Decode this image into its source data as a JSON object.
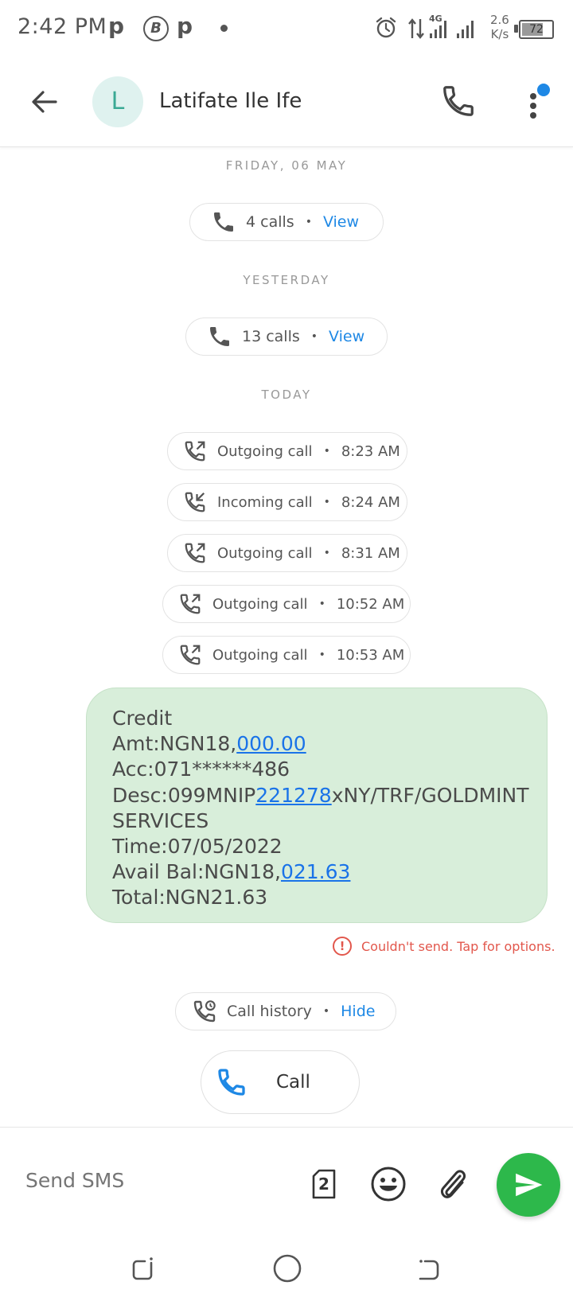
{
  "status_bar": {
    "time": "2:42 PM",
    "notification_icons": [
      "p",
      "B",
      "p"
    ],
    "network": "4G",
    "speed_value": "2.6",
    "speed_unit": "K/s",
    "battery": "72"
  },
  "header": {
    "avatar_letter": "L",
    "contact_name": "Latifate  Ile Ife"
  },
  "conversation": {
    "date_friday": "FRIDAY, 06 MAY",
    "friday_calls": {
      "label": "4 calls",
      "action": "View"
    },
    "date_yesterday": "YESTERDAY",
    "yesterday_calls": {
      "label": "13 calls",
      "action": "View"
    },
    "date_today": "TODAY",
    "call_log": [
      {
        "type": "Outgoing call",
        "time": "8:23 AM"
      },
      {
        "type": "Incoming call",
        "time": "8:24 AM"
      },
      {
        "type": "Outgoing call",
        "time": "8:31 AM"
      },
      {
        "type": "Outgoing call",
        "time": "10:52 AM"
      },
      {
        "type": "Outgoing call",
        "time": "10:53 AM"
      }
    ],
    "message": {
      "line1": "Credit",
      "line2_a": "Amt:NGN18,",
      "line2_link": "000.00",
      "line3": "Acc:071******486",
      "line4_a": "Desc:099MNIP",
      "line4_link": "221278",
      "line4_b": "xNY/TRF/GOLDMINT",
      "line5": "SERVICES",
      "line6": "Time:07/05/2022",
      "line7_a": "Avail Bal:NGN18,",
      "line7_link": "021.63",
      "line8": "Total:NGN21.63"
    },
    "send_error": "Couldn't send. Tap for options.",
    "call_history": {
      "label": "Call history",
      "action": "Hide"
    },
    "call_button": "Call"
  },
  "compose": {
    "placeholder": "Send SMS",
    "sim_number": "2"
  },
  "colors": {
    "accent": "#1e88e5",
    "bubble": "#d8eeda",
    "send": "#2db84b",
    "error": "#e2574c"
  }
}
